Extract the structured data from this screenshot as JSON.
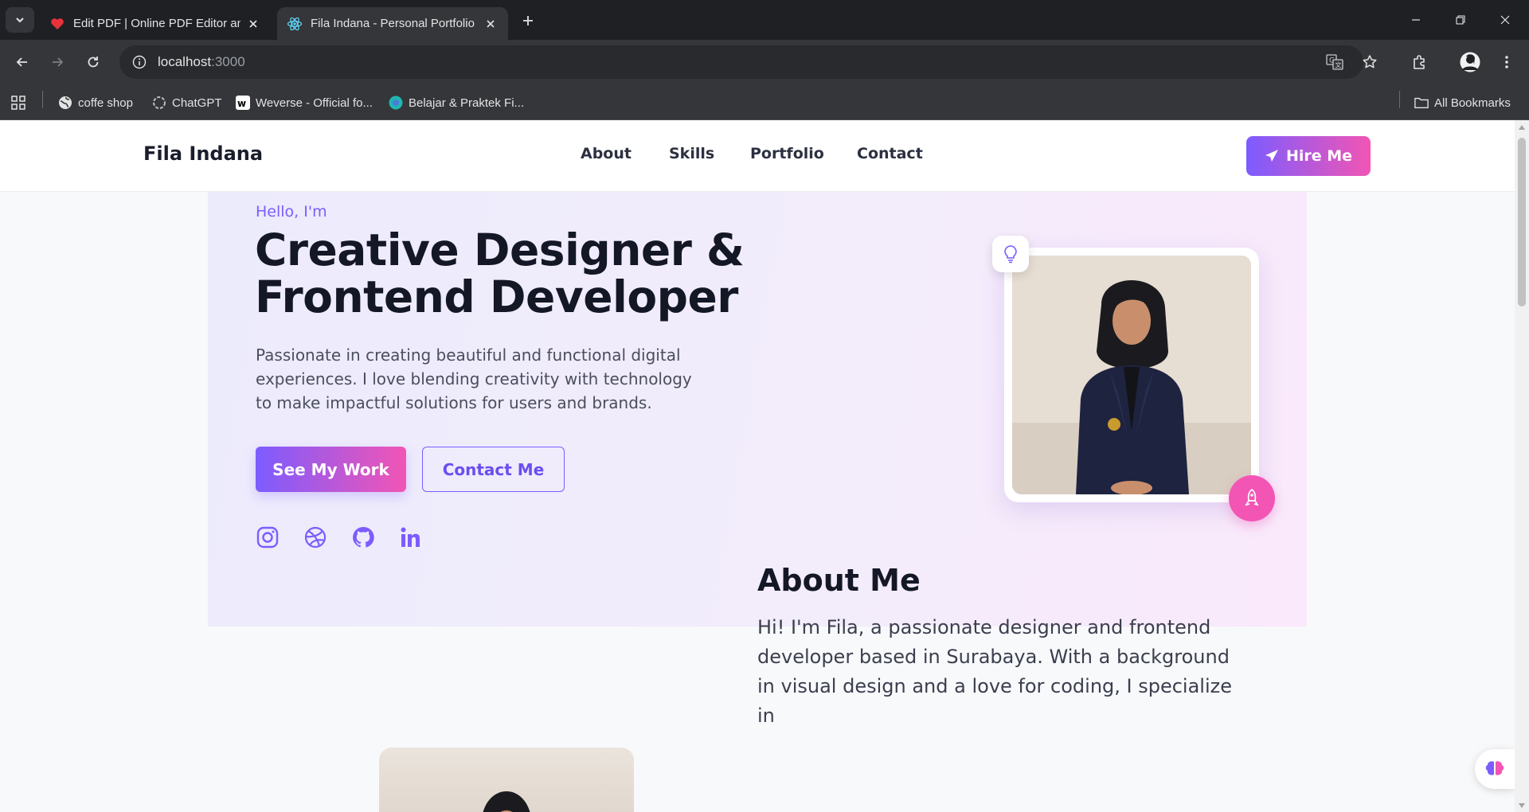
{
  "browser": {
    "tabs": [
      {
        "title": "Edit PDF | Online PDF Editor and Form Filler",
        "active": false
      },
      {
        "title": "Fila Indana - Personal Portfolio",
        "active": true
      }
    ],
    "url_host": "localhost",
    "url_port": ":3000",
    "bookmarks": [
      {
        "label": "coffe shop"
      },
      {
        "label": "ChatGPT"
      },
      {
        "label": "Weverse - Official fo..."
      },
      {
        "label": "Belajar & Praktek Fi..."
      }
    ],
    "all_bookmarks": "All Bookmarks"
  },
  "site": {
    "logo": "Fila Indana",
    "nav": [
      "About",
      "Skills",
      "Portfolio",
      "Contact"
    ],
    "hire_label": "Hire Me"
  },
  "hero": {
    "greeting": "Hello, I'm",
    "headline_line1": "Creative Designer &",
    "headline_line2": "Frontend Developer",
    "description": "Passionate in creating beautiful and functional digital experiences. I love blending creativity with technology to make impactful solutions for users and brands.",
    "primary_cta": "See My Work",
    "secondary_cta": "Contact Me",
    "socials": [
      "instagram-icon",
      "dribbble-icon",
      "github-icon",
      "linkedin-icon"
    ]
  },
  "about": {
    "title": "About Me",
    "text": "Hi! I'm Fila, a passionate designer and frontend developer based in Surabaya. With a background in visual design and a love for coding, I specialize in"
  },
  "colors": {
    "accent_purple": "#7c5cff",
    "accent_pink": "#f255b4",
    "text_dark": "#141726",
    "chrome_dark": "#1f2024"
  }
}
